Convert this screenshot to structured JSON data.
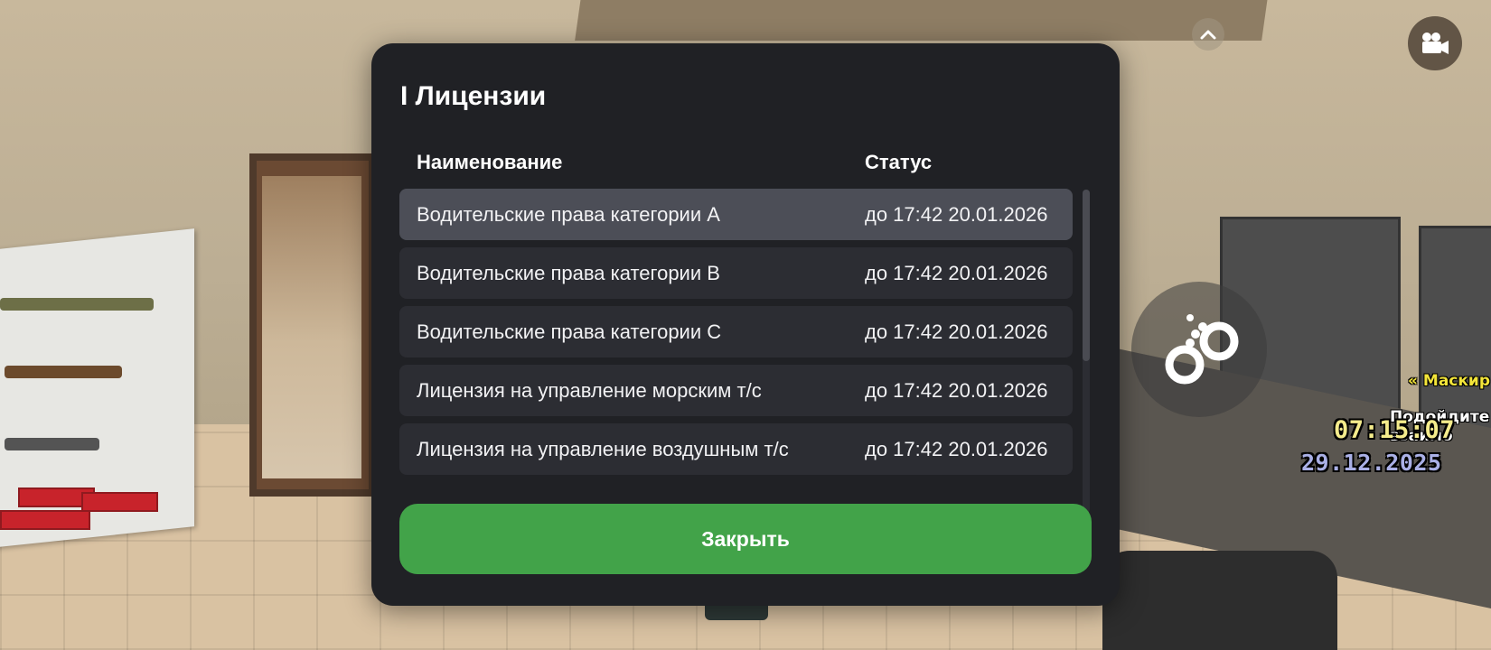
{
  "dialog": {
    "title": "I Лицензии",
    "headers": {
      "name": "Наименование",
      "status": "Статус"
    },
    "rows": [
      {
        "name": "Водительские права категории A",
        "status": "до 17:42 20.01.2026",
        "selected": true
      },
      {
        "name": "Водительские права категории B",
        "status": "до 17:42 20.01.2026",
        "selected": false
      },
      {
        "name": "Водительские права категории C",
        "status": "до 17:42 20.01.2026",
        "selected": false
      },
      {
        "name": "Лицензия на управление морским т/с",
        "status": "до 17:42 20.01.2026",
        "selected": false
      },
      {
        "name": "Лицензия на управление воздушным т/с",
        "status": "до 17:42 20.01.2026",
        "selected": false
      }
    ],
    "close_label": "Закрыть"
  },
  "hud": {
    "time": "07:15:07",
    "date": "29.12.2025",
    "side_label": "« Маскир",
    "side_text_line1": "Подойдите",
    "side_text_line2": "взаимо",
    "icons": {
      "collapse": "chevron-up-icon",
      "camera": "video-camera-icon",
      "cuffs": "handcuffs-icon"
    }
  },
  "colors": {
    "dialog_bg": "#202125",
    "row_bg": "#2c2d33",
    "row_selected_bg": "#4c4e57",
    "close_button": "#42a349",
    "hud_time": "#f5ec8c",
    "hud_date": "#aab0e6",
    "side_label": "#f3e53a"
  }
}
